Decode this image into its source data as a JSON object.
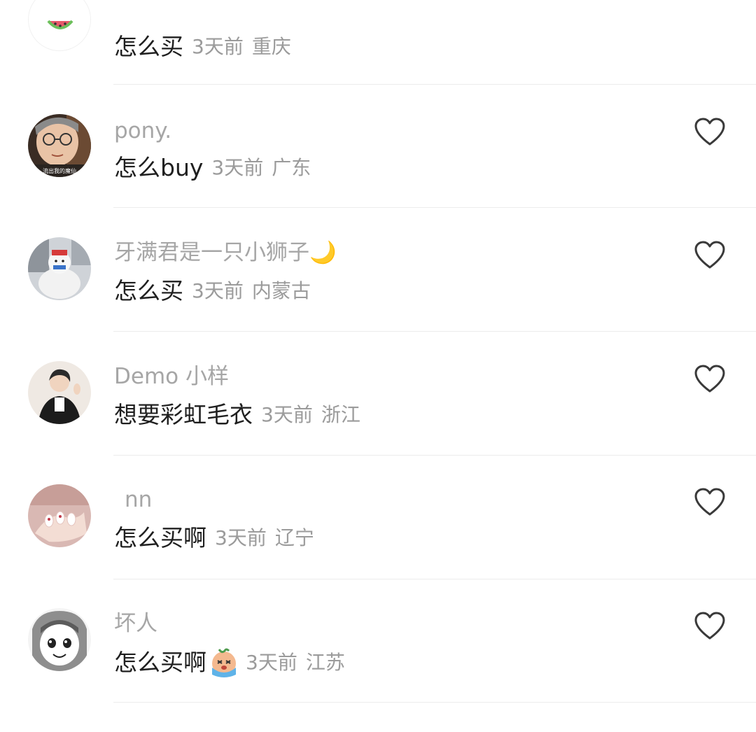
{
  "comments": [
    {
      "username": "",
      "content": "怎么买",
      "time": "3天前",
      "location": "重庆",
      "avatar": "watermelon-avatar"
    },
    {
      "username": "pony.",
      "content": "怎么buy",
      "time": "3天前",
      "location": "广东",
      "avatar": "elderly-man-glasses-avatar",
      "like_icon": "heart-outline-icon"
    },
    {
      "username": "牙满君是一只小狮子🌙",
      "content": "怎么买",
      "time": "3天前",
      "location": "内蒙古",
      "avatar": "snowman-figure-avatar",
      "like_icon": "heart-outline-icon"
    },
    {
      "username": "Demo 小样",
      "content": "想要彩虹毛衣",
      "time": "3天前",
      "location": "浙江",
      "avatar": "person-black-coat-avatar",
      "like_icon": "heart-outline-icon"
    },
    {
      "username": "nn",
      "content": "怎么买啊",
      "time": "3天前",
      "location": "辽宁",
      "avatar": "manicured-nails-avatar",
      "like_icon": "heart-outline-icon"
    },
    {
      "username": "坏人",
      "content": "怎么买啊",
      "time": "3天前",
      "location": "江苏",
      "avatar": "manga-girl-avatar",
      "content_emoji": "crying-face-emoji",
      "like_icon": "heart-outline-icon"
    }
  ],
  "colors": {
    "username": "#a6a6a6",
    "content": "#1f1f1f",
    "meta": "#9b9b9b",
    "divider": "#ececec",
    "icon": "#3a3a3a"
  }
}
